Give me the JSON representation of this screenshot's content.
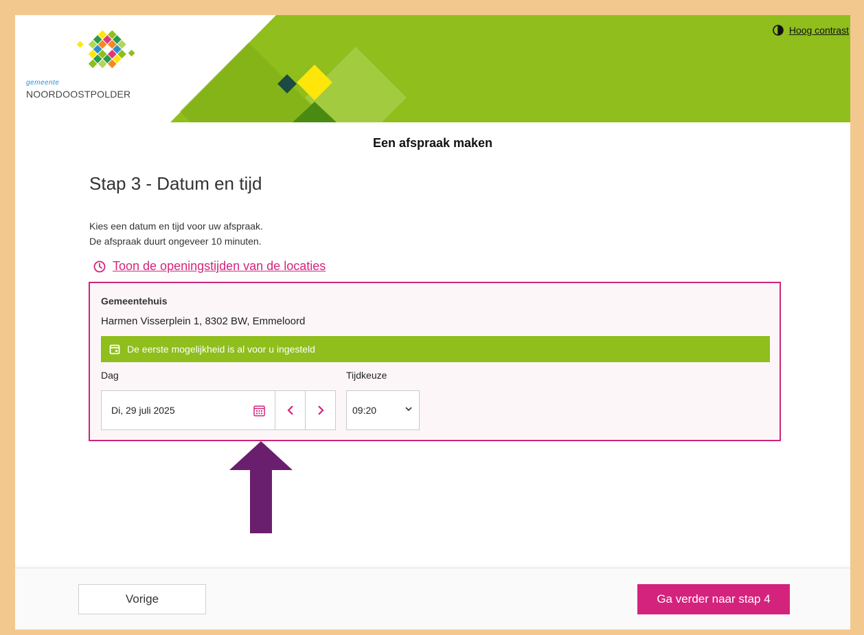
{
  "header": {
    "logo_small": "gemeente",
    "logo_big": "NOORDOOSTPOLDER",
    "contrast_label": "Hoog contrast",
    "contrast_icon": "contrast-icon"
  },
  "page_title": "Een afspraak maken",
  "step_title": "Stap 3 - Datum en tijd",
  "intro": {
    "line1": "Kies een datum en tijd voor uw afspraak.",
    "line2": "De afspraak duurt ongeveer 10 minuten."
  },
  "hours_link": {
    "label": "Toon de openingstijden van de locaties",
    "icon": "clock-icon"
  },
  "location": {
    "name": "Gemeentehuis",
    "address": "Harmen Visserplein 1, 8302 BW, Emmeloord",
    "notice": "De eerste mogelijkheid is al voor u ingesteld",
    "notice_icon": "calendar-icon",
    "day_label": "Dag",
    "day_value": "Di, 29 juli 2025",
    "time_label": "Tijdkeuze",
    "time_value": "09:20"
  },
  "footer": {
    "prev_label": "Vorige",
    "next_label": "Ga verder naar stap 4"
  },
  "colors": {
    "accent": "#d4237c",
    "banner_green": "#8fbe1d",
    "page_bg": "#f3c88f",
    "annotation_arrow": "#6a1f6e"
  }
}
